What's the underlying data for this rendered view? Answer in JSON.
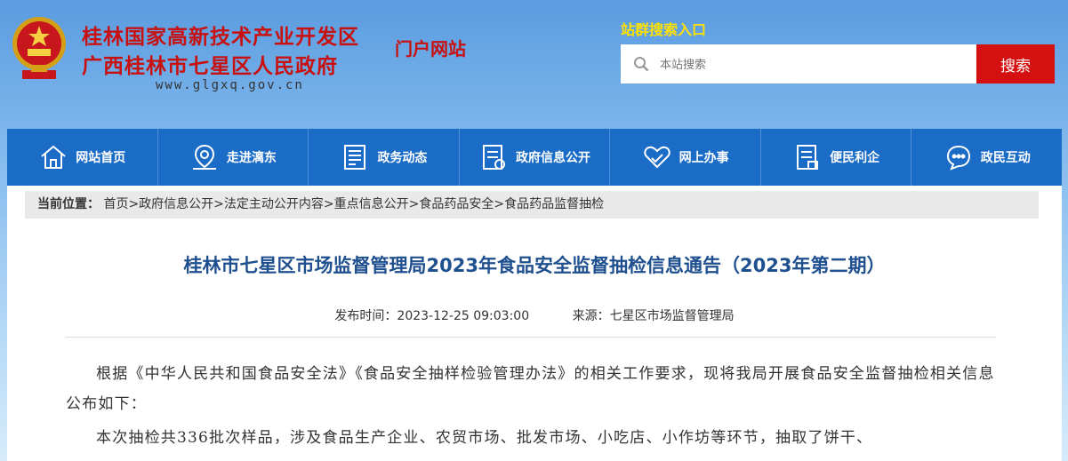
{
  "header": {
    "title_line1": "桂林国家高新技术产业开发区",
    "title_line2": "广西桂林市七星区人民政府",
    "portal_label": "门户网站",
    "domain": "www.glgxq.gov.cn"
  },
  "search": {
    "entry_label": "站群搜索入口",
    "placeholder": "本站搜索",
    "button_label": "搜索"
  },
  "nav": {
    "items": [
      {
        "label": "网站首页",
        "icon": "home-icon"
      },
      {
        "label": "走进漓东",
        "icon": "map-pin-icon"
      },
      {
        "label": "政务动态",
        "icon": "news-icon"
      },
      {
        "label": "政府信息公开",
        "icon": "document-icon"
      },
      {
        "label": "网上办事",
        "icon": "handshake-icon"
      },
      {
        "label": "便民利企",
        "icon": "form-icon"
      },
      {
        "label": "政民互动",
        "icon": "chat-icon"
      }
    ]
  },
  "breadcrumb": {
    "label": "当前位置：",
    "path": "首页>政府信息公开>法定主动公开内容>重点信息公开>食品药品安全>食品药品监督抽检"
  },
  "article": {
    "title": "桂林市七星区市场监督管理局2023年食品安全监督抽检信息通告（2023年第二期）",
    "publish_time": "发布时间：2023-12-25 09:03:00",
    "source": "来源：七星区市场监督管理局",
    "para1": "根据《中华人民共和国食品安全法》《食品安全抽样检验管理办法》的相关工作要求，现将我局开展食品安全监督抽检相关信息公布如下：",
    "para2": "本次抽检共336批次样品，涉及食品生产企业、农贸市场、批发市场、小吃店、小作坊等环节，抽取了饼干、"
  },
  "colors": {
    "title_red": "#c81010",
    "nav_blue": "#1b6cc6",
    "search_red": "#d51010",
    "accent_yellow": "#ffe100",
    "article_title_blue": "#1e4f8f"
  }
}
